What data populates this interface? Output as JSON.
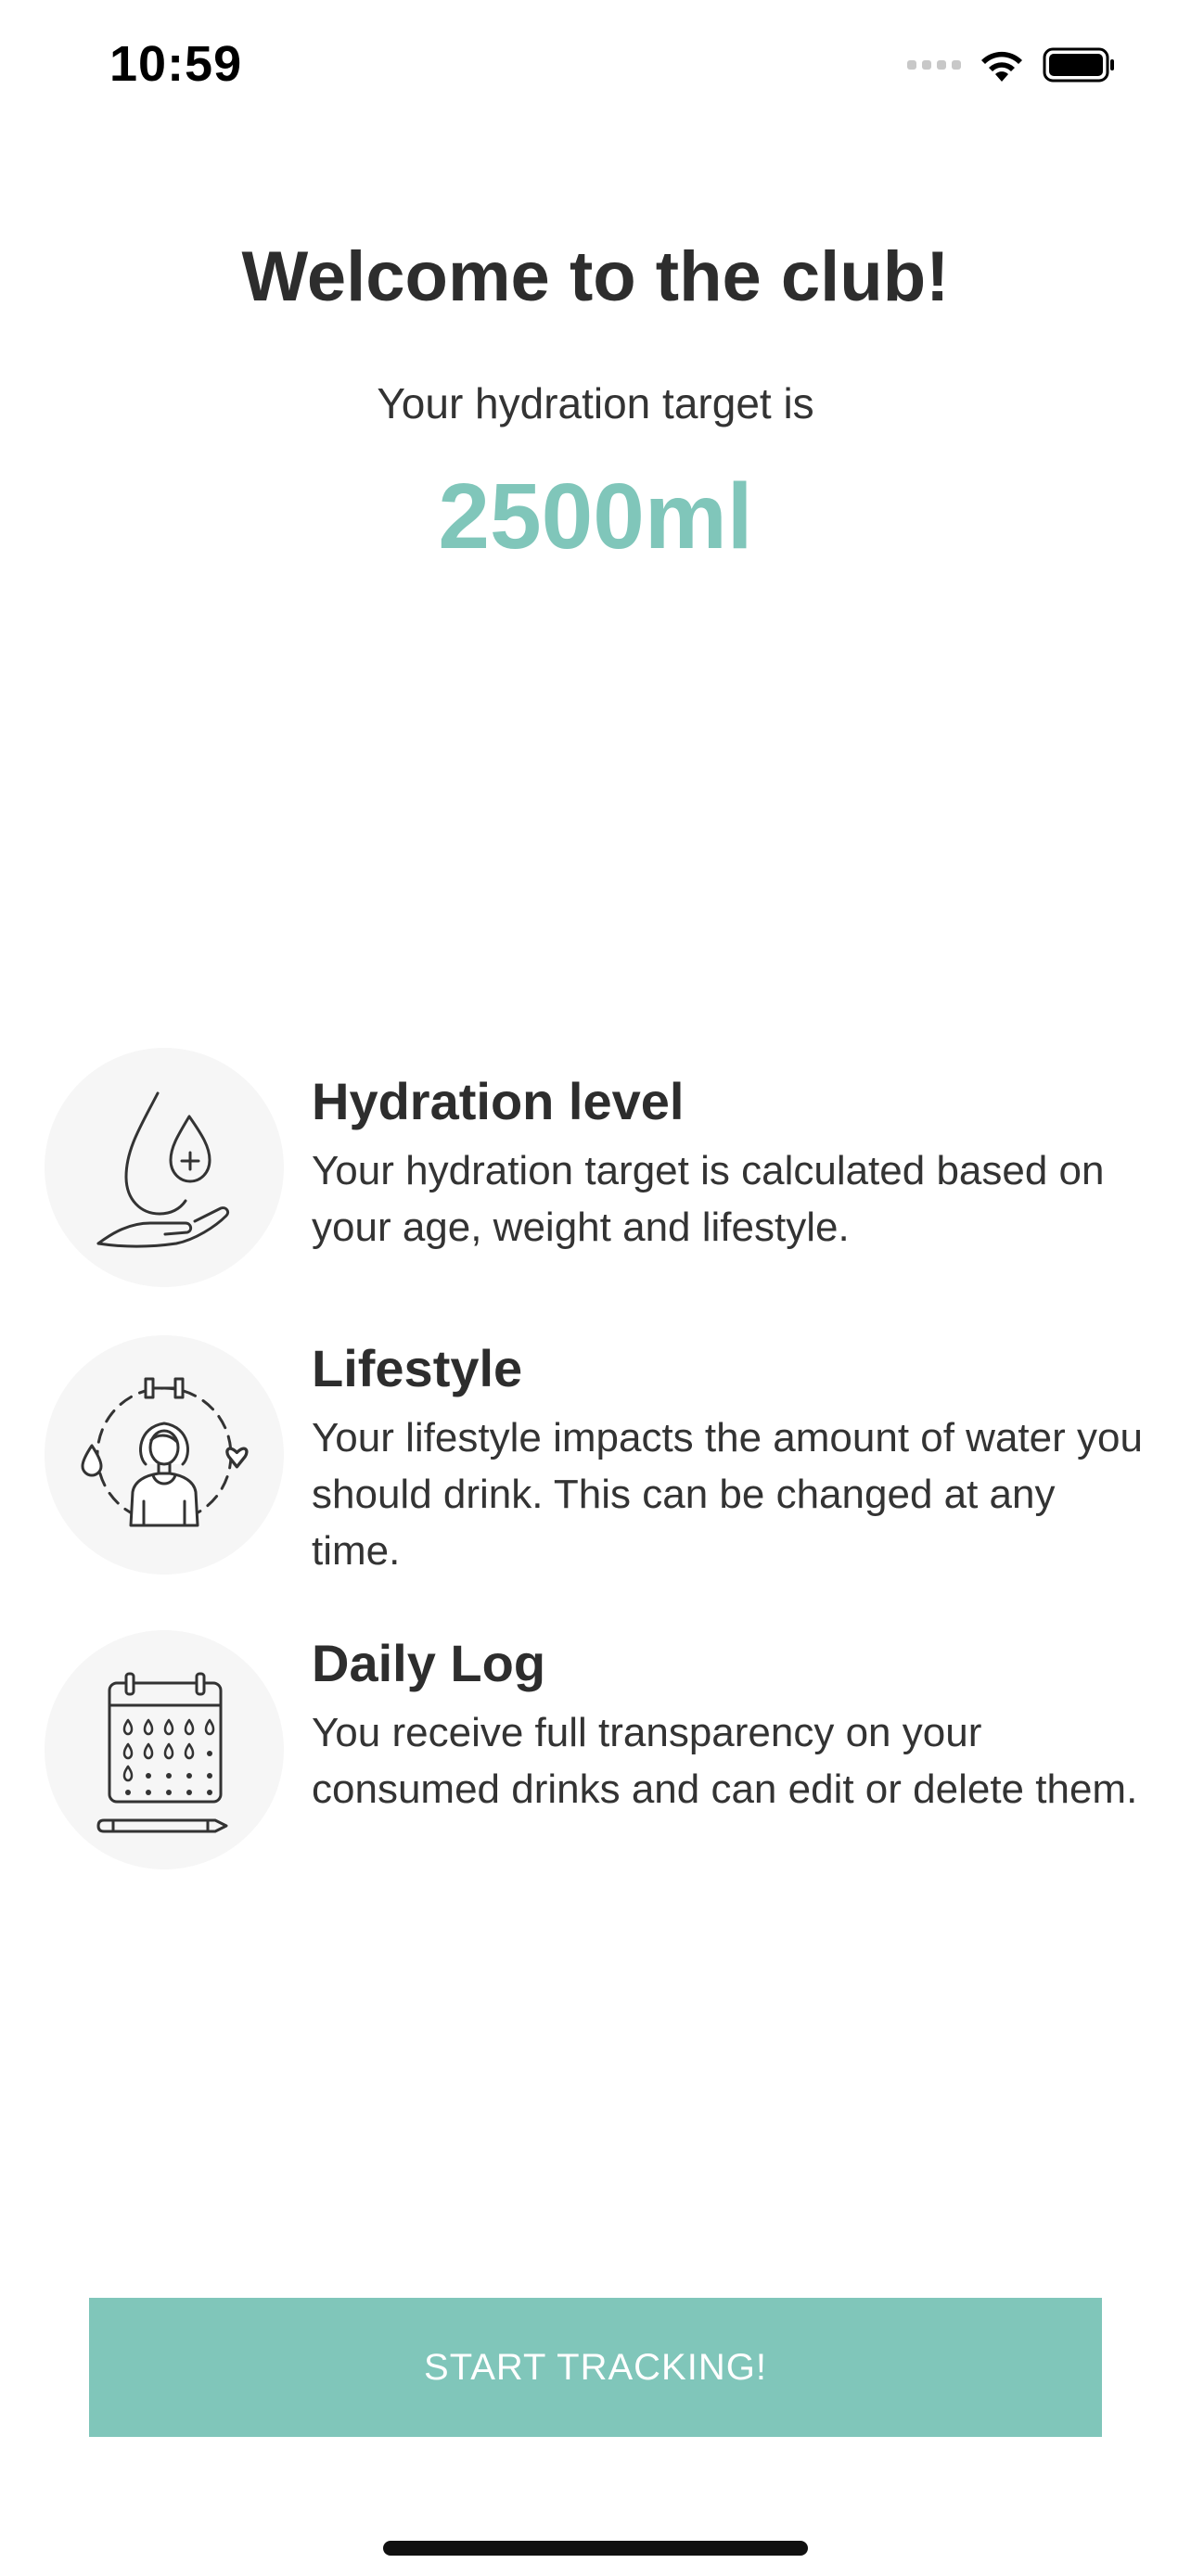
{
  "status_bar": {
    "time": "10:59",
    "icons": [
      "cellular-signal-icon",
      "wifi-icon",
      "battery-icon"
    ]
  },
  "header": {
    "title": "Welcome to the club!",
    "target_label": "Your hydration target is",
    "target_value": "2500ml"
  },
  "features": [
    {
      "icon": "hand-water-drop-icon",
      "title": "Hydration level",
      "description": "Your hydration target is calculated based on your age, weight and lifestyle."
    },
    {
      "icon": "person-lifestyle-icon",
      "title": "Lifestyle",
      "description": "Your lifestyle impacts the amount of water you should drink. This can be changed at any time."
    },
    {
      "icon": "calendar-log-icon",
      "title": "Daily Log",
      "description": "You receive full transparency on your consumed drinks and can edit or delete them."
    }
  ],
  "cta": {
    "label": "START TRACKING!"
  },
  "colors": {
    "accent": "#80c6ba",
    "text": "#2d2d2d",
    "icon_circle": "#f6f6f6"
  }
}
